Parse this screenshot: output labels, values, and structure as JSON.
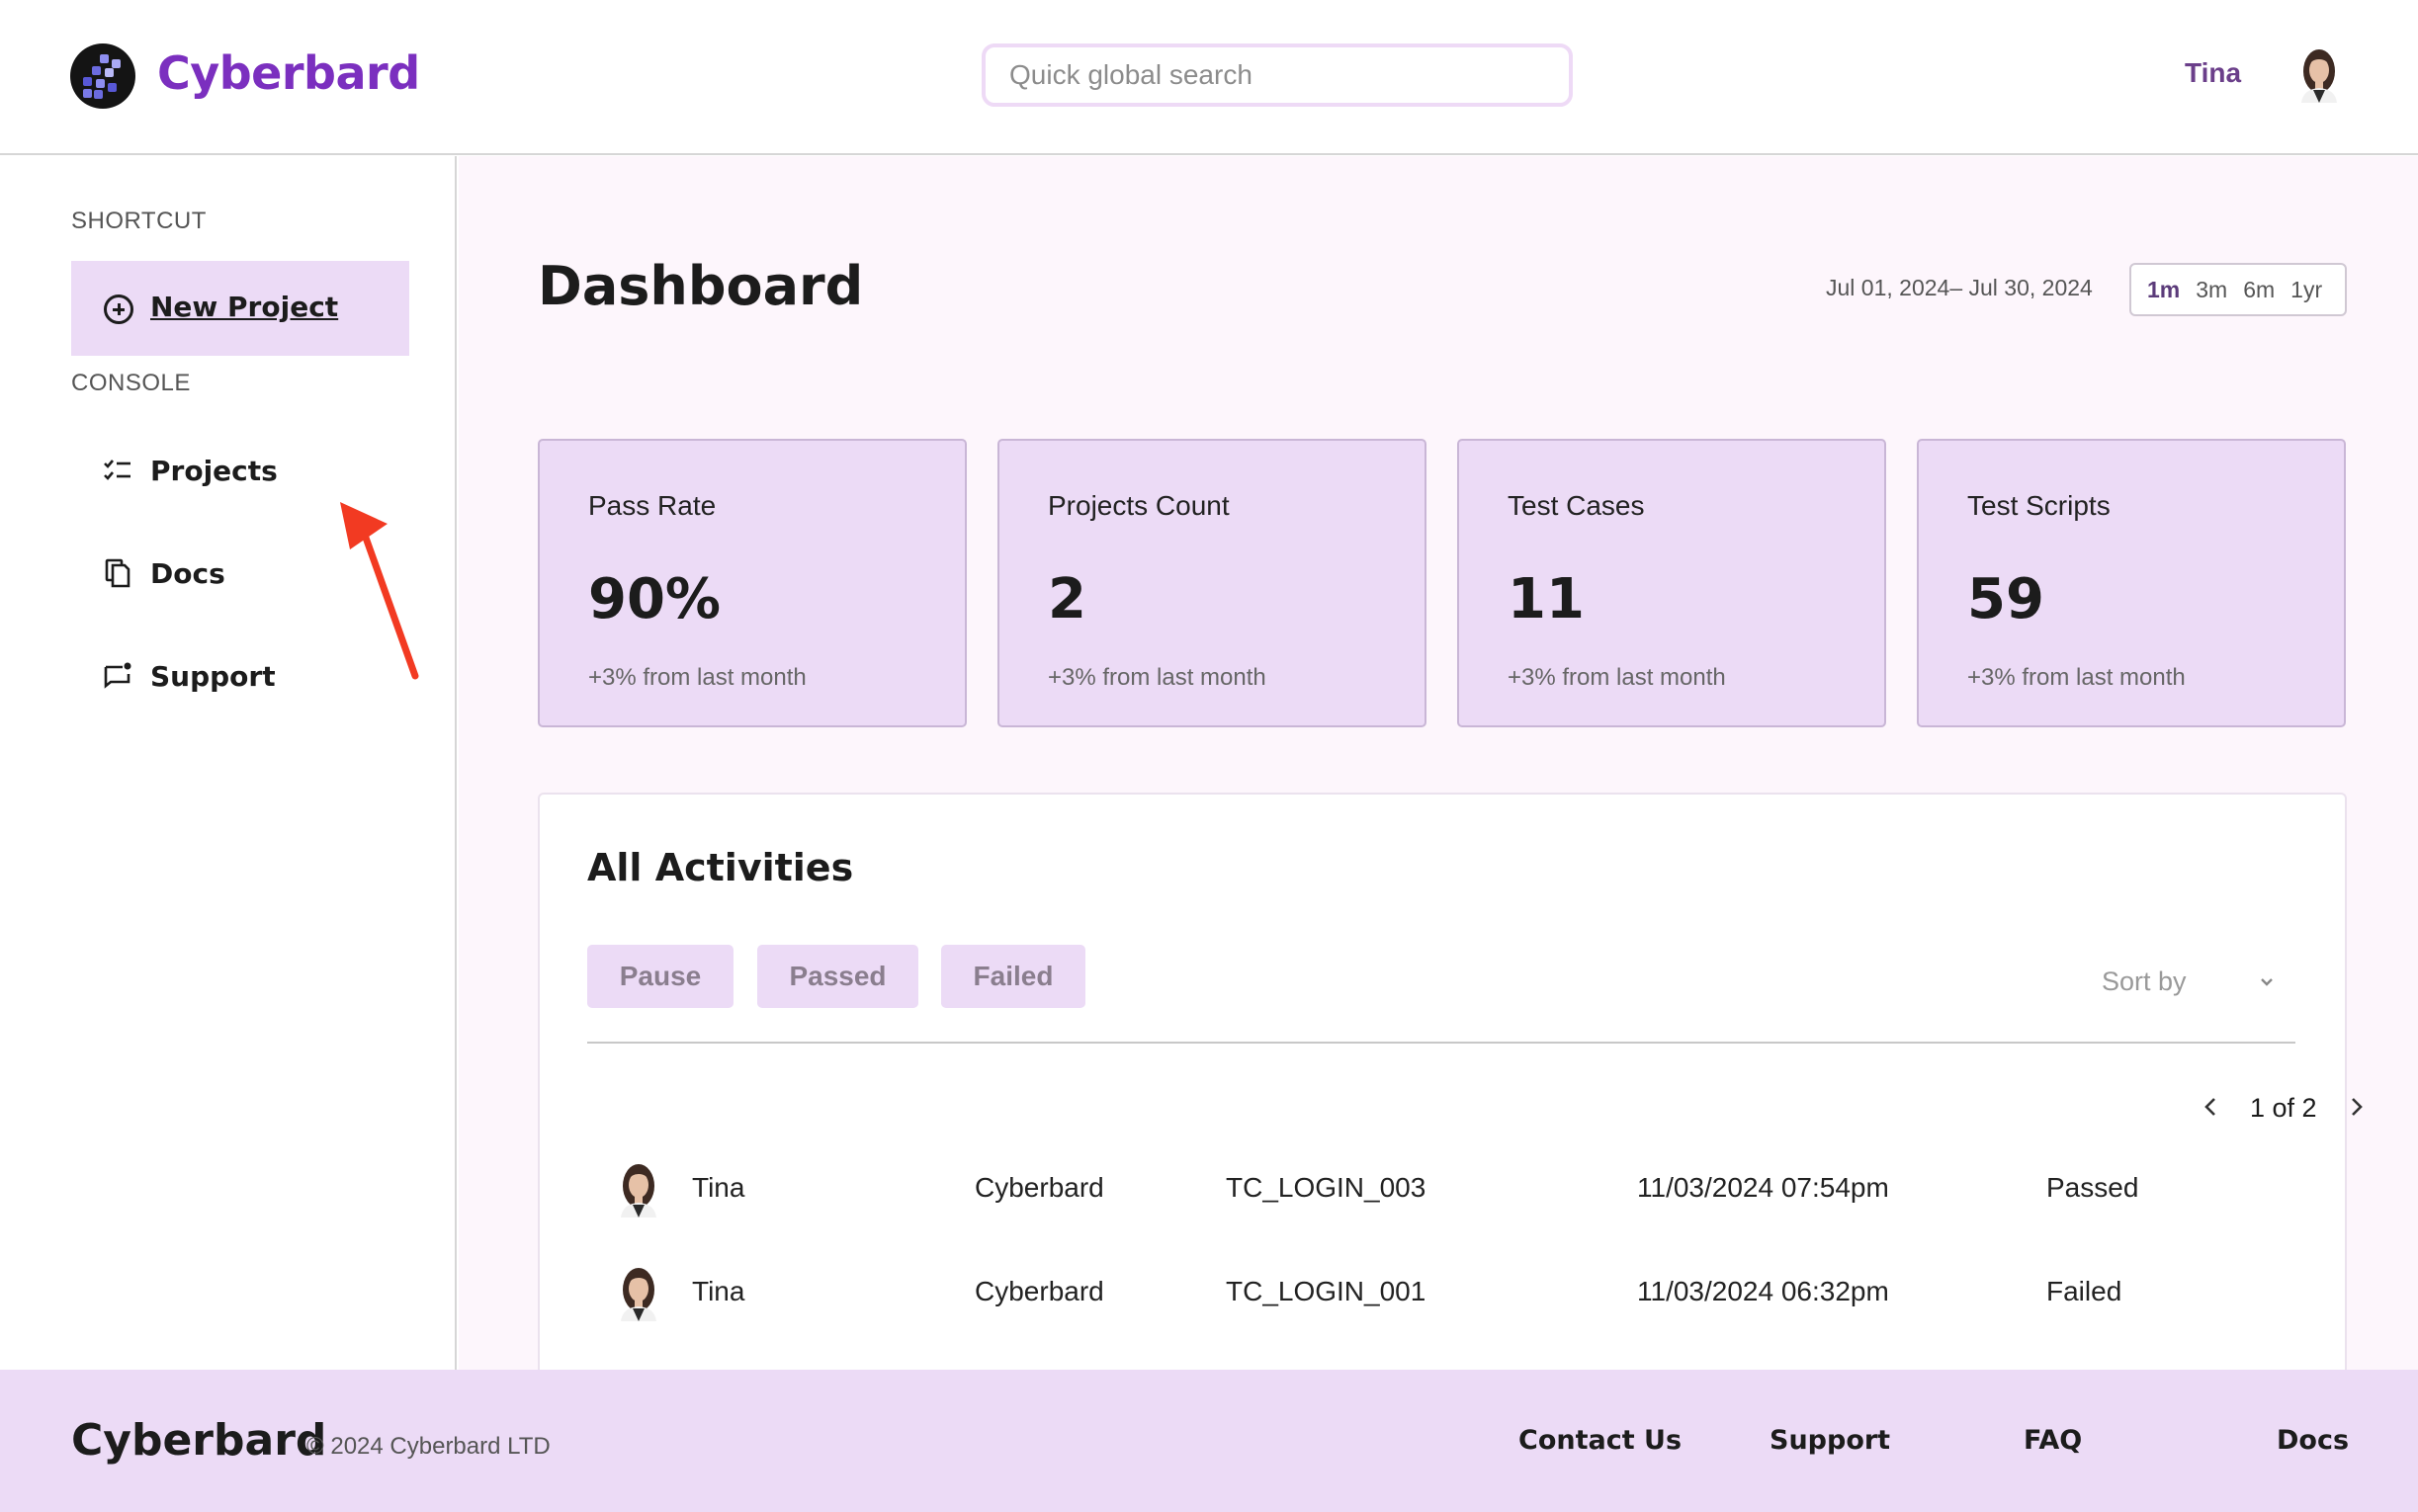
{
  "header": {
    "brand": "Cyberbard",
    "search_placeholder": "Quick global search",
    "user_name": "Tina"
  },
  "sidebar": {
    "shortcut_label": "SHORTCUT",
    "new_project_label": "New Project",
    "console_label": "CONSOLE",
    "items": [
      {
        "label": "Projects",
        "icon": "checklist-icon"
      },
      {
        "label": "Docs",
        "icon": "copy-icon"
      },
      {
        "label": "Support",
        "icon": "chat-icon"
      }
    ]
  },
  "dashboard": {
    "title": "Dashboard",
    "date_range": "Jul 01, 2024– Jul 30, 2024",
    "ranges": [
      "1m",
      "3m",
      "6m",
      "1yr"
    ],
    "active_range": "1m"
  },
  "stats": [
    {
      "title": "Pass Rate",
      "value": "90%",
      "delta": "+3% from last month"
    },
    {
      "title": "Projects Count",
      "value": "2",
      "delta": "+3% from last month"
    },
    {
      "title": "Test Cases",
      "value": "11",
      "delta": "+3% from last month"
    },
    {
      "title": "Test Scripts",
      "value": "59",
      "delta": "+3% from last month"
    }
  ],
  "activities": {
    "title": "All Activities",
    "filters": [
      "Pause",
      "Passed",
      "Failed"
    ],
    "sort_label": "Sort by",
    "pagination": "1 of 2",
    "rows": [
      {
        "user": "Tina",
        "project": "Cyberbard",
        "test_case": "TC_LOGIN_003",
        "datetime": "11/03/2024 07:54pm",
        "status": "Passed"
      },
      {
        "user": "Tina",
        "project": "Cyberbard",
        "test_case": "TC_LOGIN_001",
        "datetime": "11/03/2024 06:32pm",
        "status": "Failed"
      }
    ]
  },
  "footer": {
    "brand": "Cyberbard",
    "copyright": "© 2024 Cyberbard LTD",
    "links": [
      "Contact Us",
      "Support",
      "FAQ",
      "Docs"
    ]
  },
  "colors": {
    "brand_purple": "#7b2fbf",
    "card_bg": "#ecdbf6",
    "main_bg": "#fdf6fc",
    "annotation_arrow": "#f23a22"
  }
}
